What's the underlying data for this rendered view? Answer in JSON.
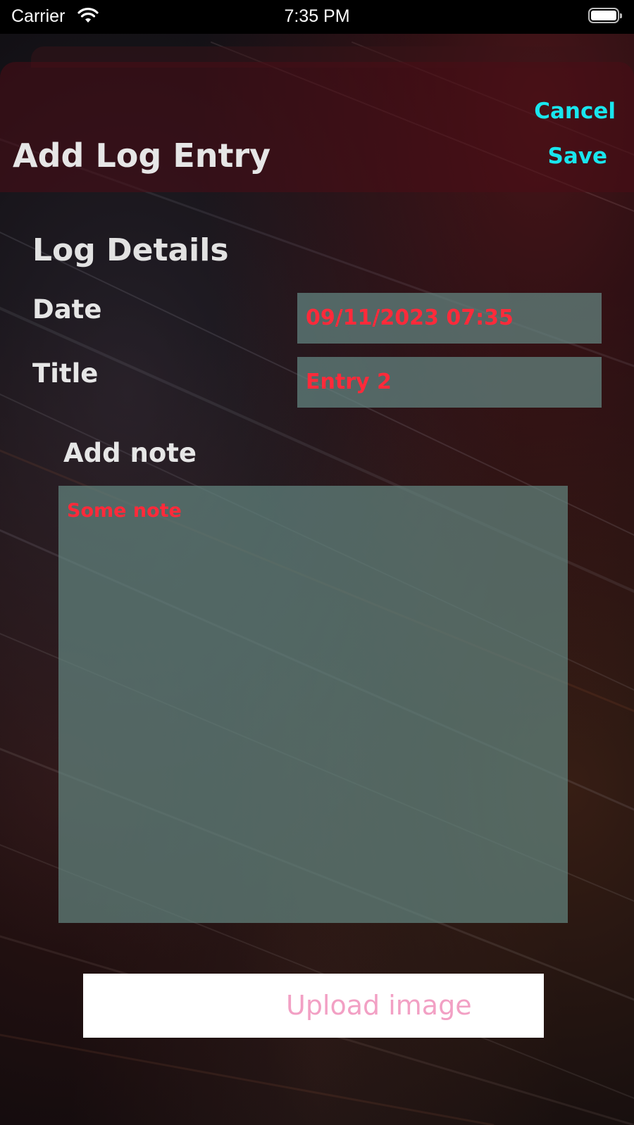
{
  "status_bar": {
    "carrier": "Carrier",
    "time": "7:35 PM",
    "wifi_icon": "wifi-icon",
    "battery_icon": "battery-icon",
    "battery_level": 1.0
  },
  "nav": {
    "title": "Add Log Entry",
    "cancel_label": "Cancel",
    "save_label": "Save"
  },
  "form": {
    "section_title": "Log Details",
    "date_label": "Date",
    "date_value": "09/11/2023 07:35",
    "title_label": "Title",
    "title_value": "Entry 2",
    "note_label": "Add note",
    "note_value": "Some note",
    "upload_label": "Upload image"
  },
  "colors": {
    "accent": "#19e6ee",
    "field_text": "#ff2a3a",
    "field_background": "#648782",
    "upload_text": "#f2a0c4"
  }
}
